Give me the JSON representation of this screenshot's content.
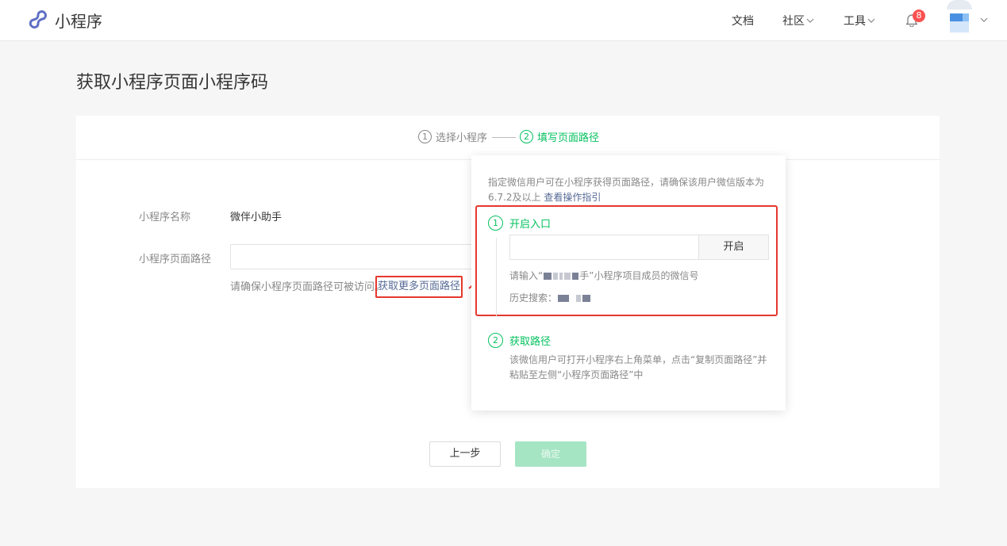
{
  "header": {
    "brand": "小程序",
    "nav": {
      "docs": "文档",
      "community": "社区",
      "tools": "工具"
    },
    "notification_count": "8",
    "colors": {
      "logo": "#5f6fc4",
      "badge": "#fa5151"
    }
  },
  "page": {
    "title": "获取小程序页面小程序码"
  },
  "steps": [
    {
      "num": "1",
      "label": "选择小程序"
    },
    {
      "num": "2",
      "label": "填写页面路径"
    }
  ],
  "form": {
    "name_label": "小程序名称",
    "name_value": "微伴小助手",
    "path_label": "小程序页面路径",
    "path_value": "",
    "hint": "请确保小程序页面路径可被访问。",
    "more_paths_link": "获取更多页面路径"
  },
  "buttons": {
    "prev": "上一步",
    "confirm": "确定"
  },
  "popover": {
    "desc": "指定微信用户可在小程序获得页面路径，请确保该用户微信版本为6.7.2及以上",
    "guide_link": "查看操作指引",
    "step1": {
      "num": "1",
      "label": "开启入口"
    },
    "wechat_input_value": "",
    "open_button": "开启",
    "member_hint_prefix": "请输入“",
    "member_hint_masked_suffix": "手",
    "member_hint_rest": "”小程序项目成员的微信号",
    "history_label": "历史搜索：",
    "step2": {
      "num": "2",
      "label": "获取路径"
    },
    "step2_desc": "该微信用户可打开小程序右上角菜单，点击“复制页面路径”并粘贴至左侧“小程序页面路径”中"
  },
  "colors": {
    "accent_green": "#07c160",
    "highlight_red": "#e5382e",
    "link_blue": "#576b95"
  }
}
